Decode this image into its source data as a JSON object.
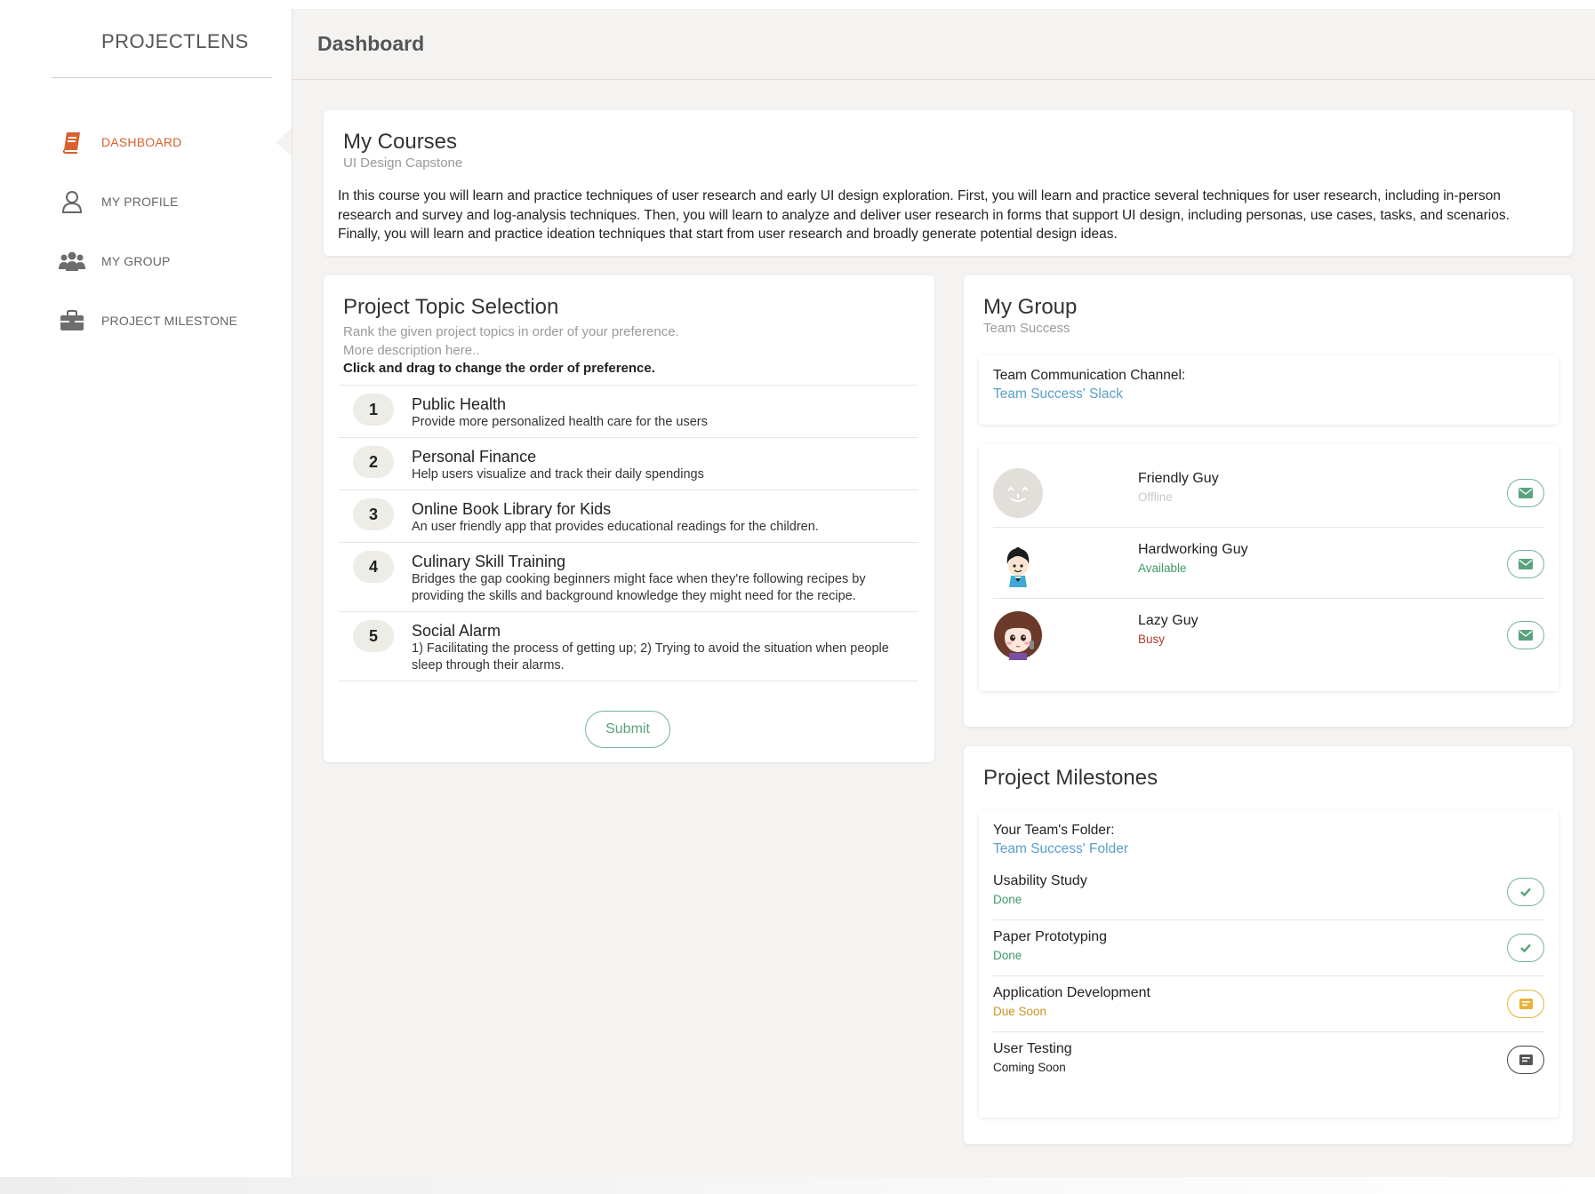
{
  "app": {
    "brand": "PROJECTLENS",
    "page_title": "Dashboard"
  },
  "sidebar": {
    "items": [
      {
        "label": "DASHBOARD",
        "icon": "book-icon",
        "active": true
      },
      {
        "label": "MY PROFILE",
        "icon": "user-icon",
        "active": false
      },
      {
        "label": "MY GROUP",
        "icon": "group-icon",
        "active": false
      },
      {
        "label": "PROJECT MILESTONE",
        "icon": "briefcase-icon",
        "active": false
      }
    ]
  },
  "courses": {
    "title": "My Courses",
    "subtitle": "UI Design Capstone",
    "description": "In this course you will learn and practice techniques of user research and early UI design exploration. First, you will learn and practice several techniques for user research, including in-person research and survey and log-analysis techniques. Then, you will learn to analyze and deliver user research in forms that support UI design, including personas, use cases, tasks, and scenarios. Finally, you will learn and practice ideation techniques that start from user research and broadly generate potential design ideas."
  },
  "topics": {
    "title": "Project Topic Selection",
    "hint1": "Rank the given project topics in order of your preference.",
    "hint2": "More description here..",
    "instruction": "Click and drag to change the order of preference.",
    "items": [
      {
        "rank": "1",
        "name": "Public Health",
        "desc": "Provide more personalized health care for the users"
      },
      {
        "rank": "2",
        "name": "Personal Finance",
        "desc": "Help users visualize and track their daily spendings"
      },
      {
        "rank": "3",
        "name": "Online Book Library for Kids",
        "desc": "An user friendly app that provides educational readings for the children."
      },
      {
        "rank": "4",
        "name": "Culinary Skill Training",
        "desc": "Bridges the gap cooking beginners might face when they're following recipes by providing the skills and background knowledge they might need for the recipe."
      },
      {
        "rank": "5",
        "name": "Social Alarm",
        "desc": "1) Facilitating the process of getting up; 2) Trying to avoid the situation when people sleep through their alarms."
      }
    ],
    "submit_label": "Submit"
  },
  "group": {
    "title": "My Group",
    "subtitle": "Team Success",
    "channel_label": "Team Communication Channel:",
    "channel_link": "Team Success' Slack",
    "members": [
      {
        "name": "Friendly Guy",
        "status": "Offline",
        "status_color": "#c8c8c8"
      },
      {
        "name": "Hardworking Guy",
        "status": "Available",
        "status_color": "#3e9a6a"
      },
      {
        "name": "Lazy Guy",
        "status": "Busy",
        "status_color": "#b03a2e"
      }
    ]
  },
  "milestones": {
    "title": "Project Milestones",
    "folder_label": "Your Team's Folder:",
    "folder_link": "Team Success' Folder",
    "items": [
      {
        "name": "Usability Study",
        "status": "Done",
        "status_color": "#3e9a6a",
        "icon": "check-icon"
      },
      {
        "name": "Paper Prototyping",
        "status": "Done",
        "status_color": "#3e9a6a",
        "icon": "check-icon"
      },
      {
        "name": "Application Development",
        "status": "Due Soon",
        "status_color": "#c8921f",
        "icon": "calendar-icon"
      },
      {
        "name": "User Testing",
        "status": "Coming Soon",
        "status_color": "#222222",
        "icon": "calendar-icon"
      }
    ]
  },
  "colors": {
    "accent": "#d9602f",
    "green": "#74b596",
    "link": "#5a9fc7",
    "warning": "#e9b23a",
    "background": "#f4f3f1"
  }
}
